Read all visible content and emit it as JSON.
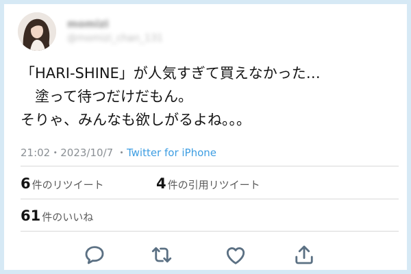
{
  "tweet": {
    "author": {
      "name": "momizi",
      "handle": "@momizi_chan_131"
    },
    "text_lines": [
      "「HARI-SHINE」が人気すぎて買えなかった…",
      "　塗って待つだけだもん。",
      "そりゃ、みんなも欲しがるよね。。。"
    ],
    "time": "21:02",
    "date": "2023/10/7",
    "source": "Twitter for iPhone",
    "stats": {
      "retweets_count": "6",
      "retweets_label": "件のリツイート",
      "quotes_count": "4",
      "quotes_label": "件の引用リツイート",
      "likes_count": "61",
      "likes_label": "件のいいね"
    }
  },
  "actions": [
    {
      "icon": "reply-icon"
    },
    {
      "icon": "retweet-icon"
    },
    {
      "icon": "like-icon"
    },
    {
      "icon": "share-icon"
    }
  ],
  "colors": {
    "frame": "#d6e9f5",
    "link": "#3c9de2",
    "icon": "#5b7083"
  }
}
